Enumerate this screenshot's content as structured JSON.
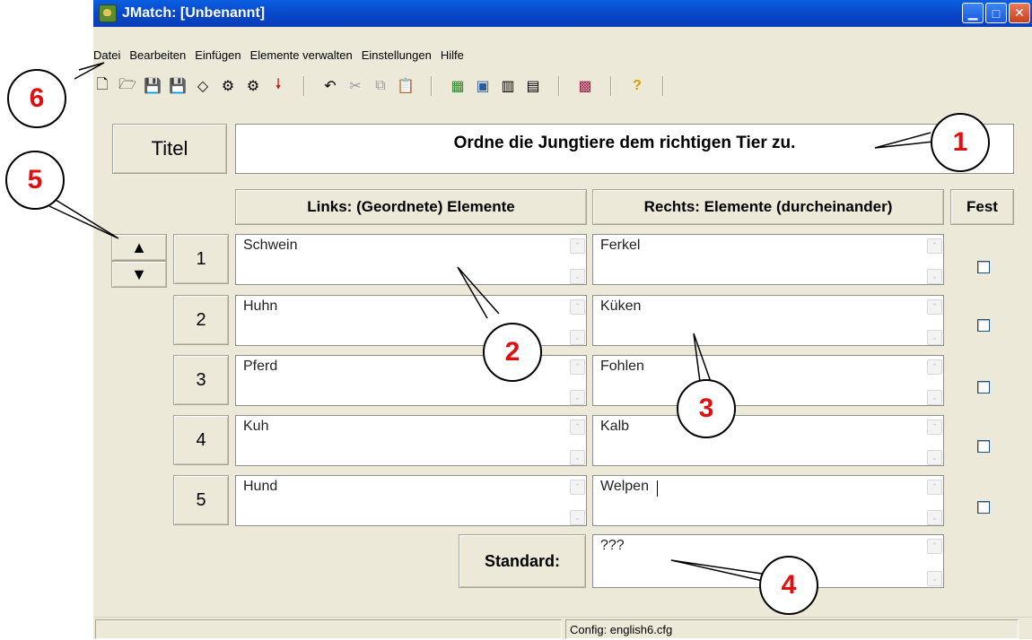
{
  "window": {
    "title": "JMatch: [Unbenannt]",
    "buttons": [
      "minimize",
      "maximize",
      "close"
    ]
  },
  "menu": [
    "Datei",
    "Bearbeiten",
    "Einfügen",
    "Elemente verwalten",
    "Einstellungen",
    "Hilfe"
  ],
  "toolbar": {
    "groups": [
      [
        "new-file-icon",
        "open-folder-icon",
        "save-icon",
        "save-as-icon",
        "erase-icon",
        "export-web-icon",
        "export-web-6-icon",
        "insert-arrow-icon"
      ],
      [
        "undo-icon",
        "cut-icon",
        "copy-icon",
        "paste-icon"
      ],
      [
        "image-icon",
        "link-icon",
        "file-icon",
        "tools-icon"
      ],
      [
        "config-icon"
      ],
      [
        "help-icon"
      ]
    ]
  },
  "title_section": {
    "label": "Titel",
    "value": "Ordne die Jungtiere dem richtigen Tier zu."
  },
  "headers": {
    "left": "Links: (Geordnete) Elemente",
    "right": "Rechts: Elemente (durcheinander)",
    "fixed": "Fest"
  },
  "rows": [
    {
      "num": "1",
      "left": "Schwein",
      "right": "Ferkel"
    },
    {
      "num": "2",
      "left": "Huhn",
      "right": "Küken"
    },
    {
      "num": "3",
      "left": "Pferd",
      "right": "Fohlen"
    },
    {
      "num": "4",
      "left": "Kuh",
      "right": "Kalb"
    },
    {
      "num": "5",
      "left": "Hund",
      "right": "Welpen"
    }
  ],
  "standard": {
    "label": "Standard:",
    "value": "???"
  },
  "status": {
    "config": "Config: english6.cfg"
  },
  "callouts": [
    "1",
    "2",
    "3",
    "4",
    "5",
    "6"
  ],
  "colors": {
    "callout_text": "#e01010",
    "titlebar": "#0844c6"
  }
}
